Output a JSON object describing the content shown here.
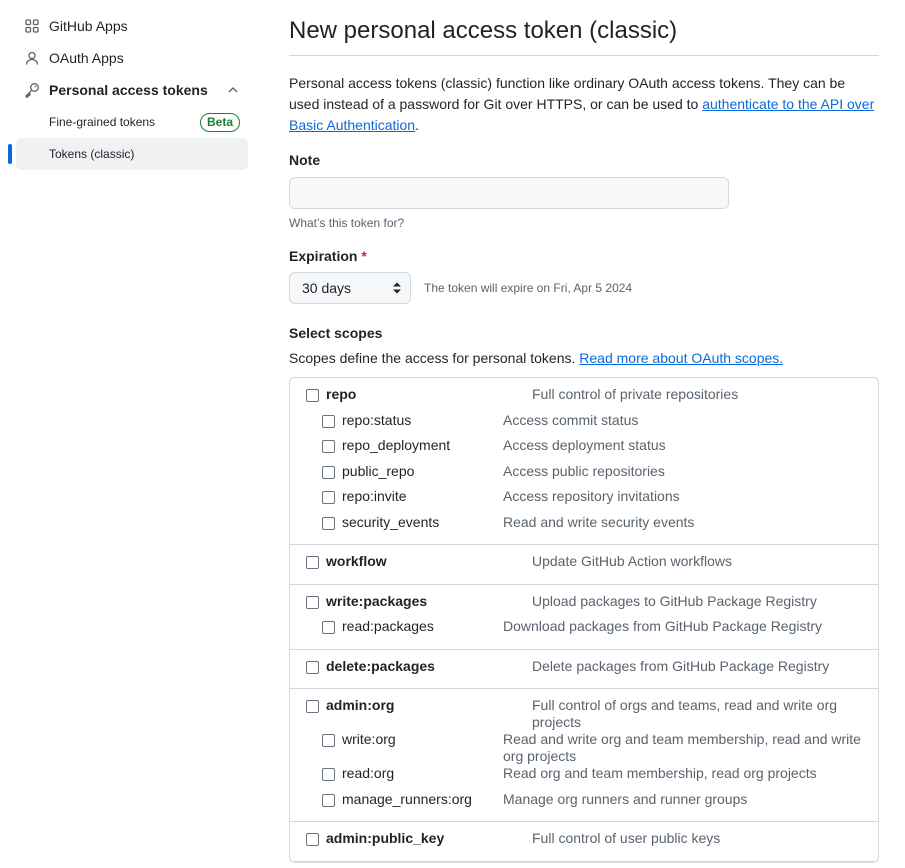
{
  "sidebar": {
    "items": [
      {
        "label": "GitHub Apps",
        "icon": "apps-grid-icon"
      },
      {
        "label": "OAuth Apps",
        "icon": "person-icon"
      },
      {
        "label": "Personal access tokens",
        "icon": "key-icon"
      }
    ],
    "sub_items": [
      {
        "label": "Fine-grained tokens",
        "badge": "Beta"
      },
      {
        "label": "Tokens (classic)"
      }
    ]
  },
  "main": {
    "title": "New personal access token (classic)",
    "intro_text": "Personal access tokens (classic) function like ordinary OAuth access tokens. They can be used instead of a password for Git over HTTPS, or can be used to ",
    "intro_link": "authenticate to the API over Basic Authentication",
    "intro_end": ".",
    "note_label": "Note",
    "note_value": "",
    "note_hint": "What’s this token for?",
    "expiration_label": "Expiration",
    "expiration_required": "*",
    "expiration_value": "30 days",
    "expiration_note": "The token will expire on Fri, Apr 5 2024",
    "scopes_label": "Select scopes",
    "scopes_desc": "Scopes define the access for personal tokens. ",
    "scopes_link": "Read more about OAuth scopes."
  },
  "scopes": [
    {
      "name": "repo",
      "desc": "Full control of private repositories",
      "children": [
        {
          "name": "repo:status",
          "desc": "Access commit status"
        },
        {
          "name": "repo_deployment",
          "desc": "Access deployment status"
        },
        {
          "name": "public_repo",
          "desc": "Access public repositories"
        },
        {
          "name": "repo:invite",
          "desc": "Access repository invitations"
        },
        {
          "name": "security_events",
          "desc": "Read and write security events"
        }
      ]
    },
    {
      "name": "workflow",
      "desc": "Update GitHub Action workflows",
      "children": []
    },
    {
      "name": "write:packages",
      "desc": "Upload packages to GitHub Package Registry",
      "children": [
        {
          "name": "read:packages",
          "desc": "Download packages from GitHub Package Registry"
        }
      ]
    },
    {
      "name": "delete:packages",
      "desc": "Delete packages from GitHub Package Registry",
      "children": []
    },
    {
      "name": "admin:org",
      "desc": "Full control of orgs and teams, read and write org projects",
      "children": [
        {
          "name": "write:org",
          "desc": "Read and write org and team membership, read and write org projects"
        },
        {
          "name": "read:org",
          "desc": "Read org and team membership, read org projects"
        },
        {
          "name": "manage_runners:org",
          "desc": "Manage org runners and runner groups"
        }
      ]
    },
    {
      "name": "admin:public_key",
      "desc": "Full control of user public keys",
      "children": []
    }
  ],
  "colors": {
    "accent": "#0969da",
    "badge": "#1a7f37",
    "required": "#d1242f"
  }
}
